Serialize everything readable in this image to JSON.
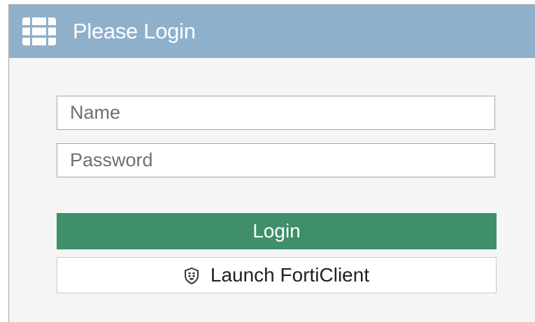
{
  "header": {
    "title": "Please Login",
    "logo_icon": "fortinet-grid-icon"
  },
  "form": {
    "name_placeholder": "Name",
    "name_value": "",
    "password_placeholder": "Password",
    "password_value": ""
  },
  "actions": {
    "login_label": "Login",
    "launch_label": "Launch FortiClient",
    "launch_icon": "forticlient-shield-icon"
  },
  "colors": {
    "header_bg": "#8fb0cb",
    "login_bg": "#3f8f6b",
    "panel_bg": "#f5f5f5"
  }
}
